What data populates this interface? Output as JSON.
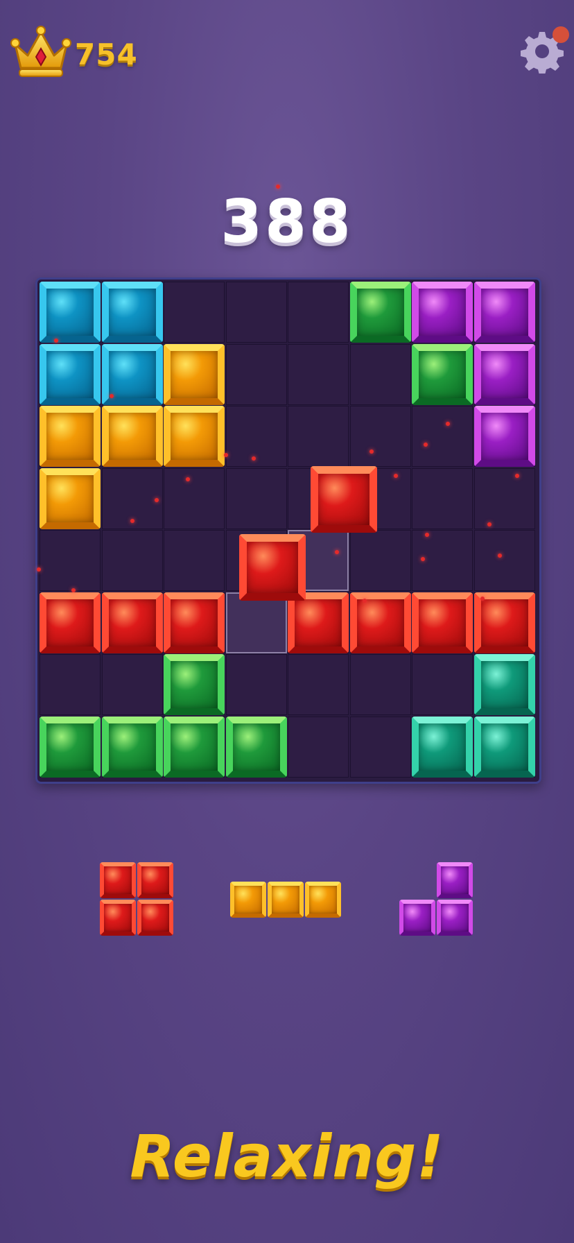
{
  "header": {
    "best_score": "754",
    "crown_icon": "crown-icon",
    "settings_icon": "gear-icon",
    "notification_color": "#d6503a"
  },
  "score": "388",
  "palette": {
    "cyan": {
      "base": "#0e93c4",
      "light": "#5fe0f8",
      "dark": "#06648f",
      "edge": "#37c7ee"
    },
    "orange": {
      "base": "#f39a06",
      "light": "#ffe15a",
      "dark": "#c46a00",
      "edge": "#ffc02a"
    },
    "green": {
      "base": "#1f9a3b",
      "light": "#9cf07a",
      "dark": "#0b6a24",
      "edge": "#48d45c"
    },
    "purple": {
      "base": "#9a1fc4",
      "light": "#f08af8",
      "dark": "#5e0c85",
      "edge": "#d14ae8"
    },
    "red": {
      "base": "#de1a1a",
      "light": "#ff8b5a",
      "dark": "#9e0b0b",
      "edge": "#ff4a34"
    },
    "teal": {
      "base": "#0f9a7a",
      "light": "#7cf2d6",
      "dark": "#066550",
      "edge": "#34d2aa"
    }
  },
  "board": {
    "rows": [
      [
        "cyan",
        "cyan",
        null,
        null,
        null,
        "green",
        "purple",
        "purple"
      ],
      [
        "cyan",
        "cyan",
        "orange",
        null,
        null,
        null,
        "green",
        "purple"
      ],
      [
        "orange",
        "orange",
        "orange",
        null,
        null,
        null,
        null,
        "purple"
      ],
      [
        "orange",
        null,
        null,
        null,
        null,
        null,
        null,
        null
      ],
      [
        null,
        null,
        null,
        null,
        null,
        null,
        null,
        null
      ],
      [
        "red",
        "red",
        "red",
        null,
        "red",
        "red",
        "red",
        "red"
      ],
      [
        null,
        null,
        "green",
        null,
        null,
        null,
        null,
        "teal"
      ],
      [
        "green",
        "green",
        "green",
        "green",
        null,
        null,
        "teal",
        "teal"
      ]
    ],
    "ghost_cells": [
      [
        4,
        4
      ],
      [
        5,
        3
      ]
    ],
    "dragging": {
      "color": "red",
      "cells": [
        [
          3,
          4.4
        ],
        [
          4.1,
          3.25
        ]
      ]
    }
  },
  "pieces": [
    {
      "color": "red",
      "cells": [
        [
          0,
          0
        ],
        [
          0,
          1
        ],
        [
          1,
          0
        ],
        [
          1,
          1
        ]
      ]
    },
    {
      "color": "orange",
      "cells": [
        [
          0,
          0
        ],
        [
          0,
          1
        ],
        [
          0,
          2
        ]
      ]
    },
    {
      "color": "purple",
      "cells": [
        [
          0,
          1
        ],
        [
          1,
          0
        ],
        [
          1,
          1
        ]
      ]
    }
  ],
  "tagline": "Relaxing!"
}
